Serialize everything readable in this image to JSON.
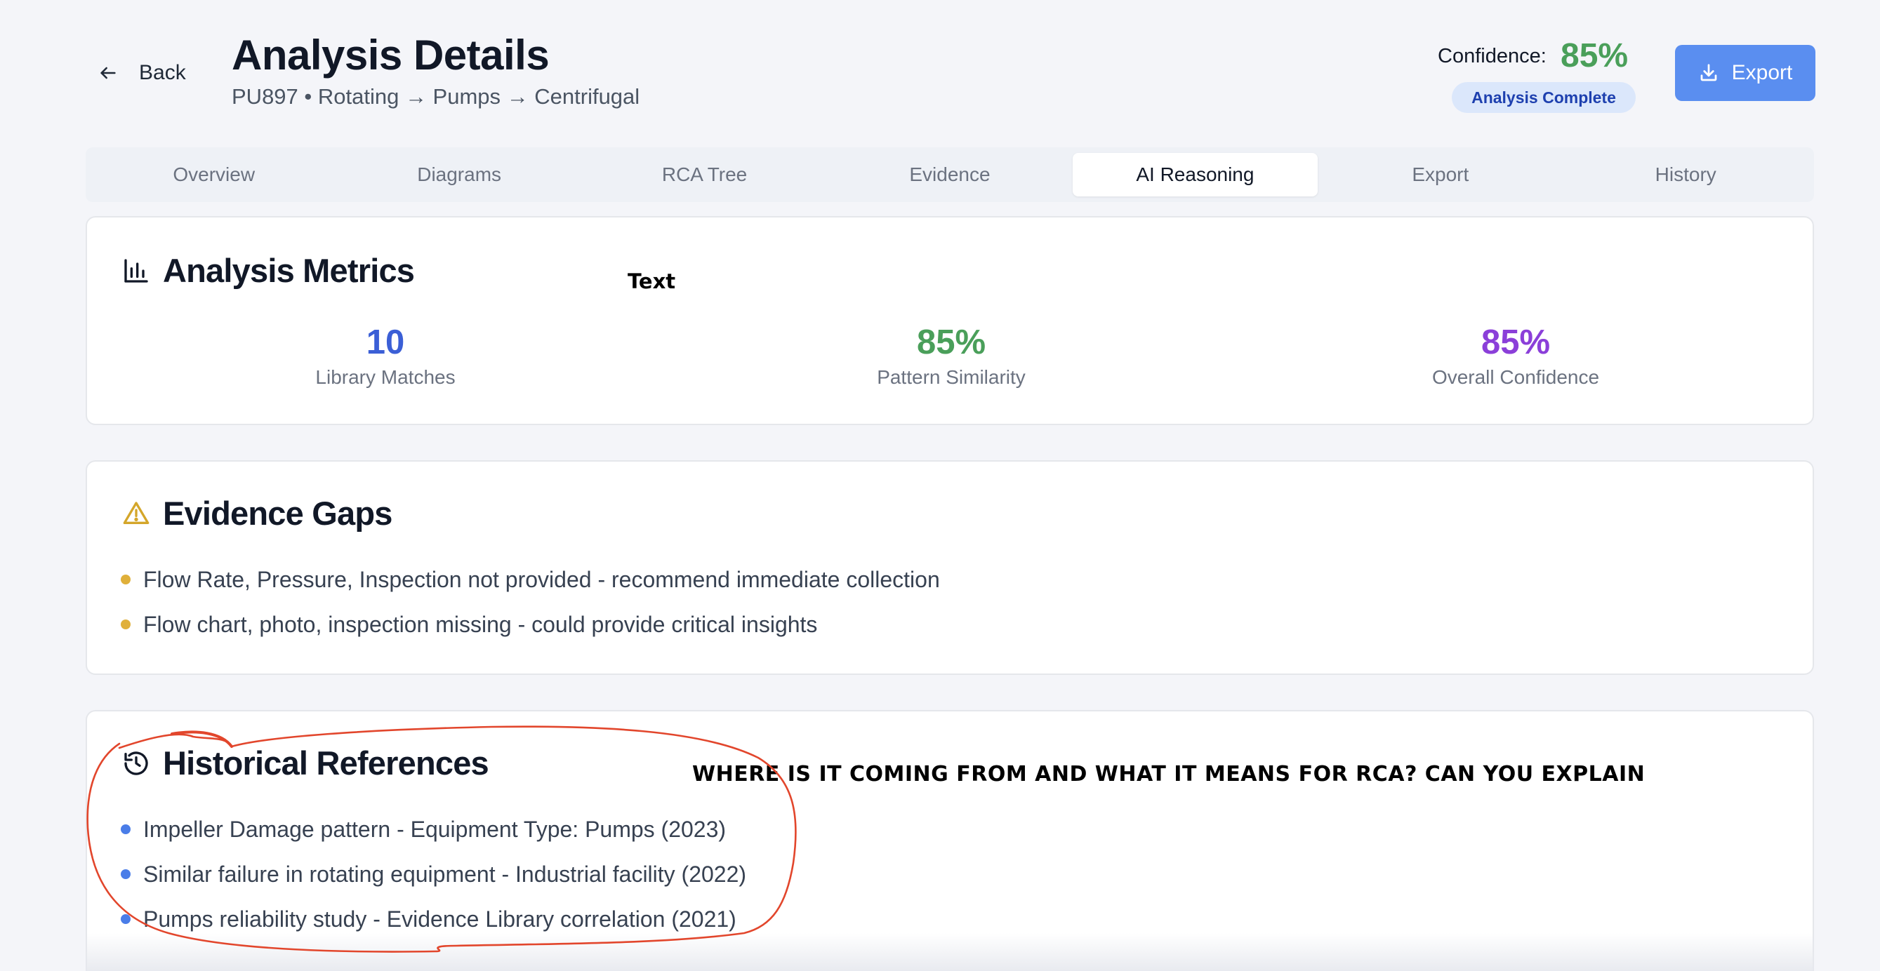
{
  "header": {
    "back_label": "Back",
    "title": "Analysis Details",
    "breadcrumb": "PU897 • Rotating → Pumps → Centrifugal",
    "confidence_label": "Confidence:",
    "confidence_value": "85%",
    "status_badge": "Analysis Complete",
    "export_label": "Export"
  },
  "tabs": [
    {
      "label": "Overview",
      "active": false
    },
    {
      "label": "Diagrams",
      "active": false
    },
    {
      "label": "RCA Tree",
      "active": false
    },
    {
      "label": "Evidence",
      "active": false
    },
    {
      "label": "AI Reasoning",
      "active": true
    },
    {
      "label": "Export",
      "active": false
    },
    {
      "label": "History",
      "active": false
    }
  ],
  "metrics": {
    "title": "Analysis Metrics",
    "annotation": "Text",
    "items": [
      {
        "value": "10",
        "label": "Library Matches",
        "color": "#3b5fd6"
      },
      {
        "value": "85%",
        "label": "Pattern Similarity",
        "color": "#4a9f5a"
      },
      {
        "value": "85%",
        "label": "Overall Confidence",
        "color": "#8b3fd9"
      }
    ]
  },
  "evidence_gaps": {
    "title": "Evidence Gaps",
    "bullet_color": "#e0b03a",
    "items": [
      "Flow Rate, Pressure, Inspection not provided - recommend immediate collection",
      "Flow chart, photo, inspection missing - could provide critical insights"
    ]
  },
  "historical": {
    "title": "Historical References",
    "bullet_color": "#4a7de8",
    "items": [
      "Impeller Damage pattern - Equipment Type: Pumps (2023)",
      "Similar failure in rotating equipment - Industrial facility (2022)",
      "Pumps reliability study - Evidence Library correlation (2021)"
    ],
    "annotation": "WHERE IS IT COMING FROM AND WHAT IT MEANS FOR RCA? CAN YOU EXPLAIN",
    "annotation_color": "#e2462c"
  },
  "colors": {
    "accent": "#5a8ef0",
    "background": "#f4f5f9"
  }
}
